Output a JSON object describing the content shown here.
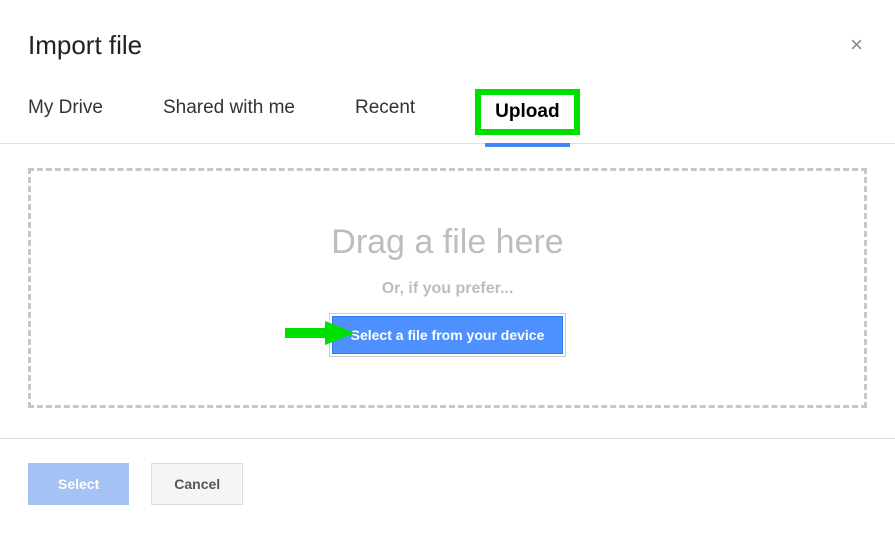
{
  "header": {
    "title": "Import file",
    "close": "×"
  },
  "tabs": {
    "my_drive": "My Drive",
    "shared": "Shared with me",
    "recent": "Recent",
    "upload": "Upload"
  },
  "dropzone": {
    "drag_text": "Drag a file here",
    "or_text": "Or, if you prefer...",
    "select_file_label": "Select a file from your device"
  },
  "footer": {
    "select_label": "Select",
    "cancel_label": "Cancel"
  },
  "annotations": {
    "highlight_color": "#00e000",
    "arrow_color": "#00e000"
  }
}
